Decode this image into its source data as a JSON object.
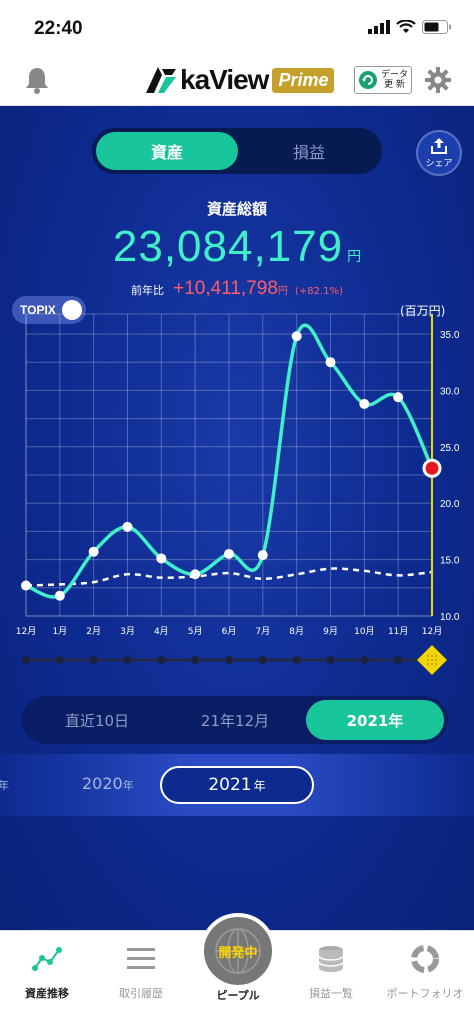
{
  "status_bar": {
    "time": "22:40"
  },
  "header": {
    "logo_text": "kaView",
    "logo_badge": "Prime",
    "data_update_line1": "データ",
    "data_update_line2": "更 新"
  },
  "tabs": {
    "active": "資産",
    "inactive": "損益"
  },
  "share_label": "シェア",
  "summary": {
    "label": "資産総額",
    "value": "23,084,179",
    "unit": "円",
    "yoy_label": "前年比",
    "yoy_value": "+10,411,798",
    "yoy_unit": "円",
    "yoy_pct": "(+82.1%)"
  },
  "topix_label": "TOPIX",
  "topix_on": true,
  "chart_data": {
    "type": "line",
    "categories": [
      "12月",
      "1月",
      "2月",
      "3月",
      "4月",
      "5月",
      "6月",
      "7月",
      "8月",
      "9月",
      "10月",
      "11月",
      "12月"
    ],
    "ylabel": "(百万円)",
    "ylim": [
      10.0,
      35.0
    ],
    "yticks": [
      "10.0",
      "15.0",
      "20.0",
      "25.0",
      "30.0",
      "35.0"
    ],
    "series": [
      {
        "values": [
          12.7,
          11.8,
          15.7,
          17.9,
          15.1,
          13.7,
          15.5,
          15.4,
          34.8,
          32.5,
          28.8,
          29.4,
          23.1
        ]
      },
      {
        "values": [
          12.7,
          12.8,
          13.0,
          13.7,
          13.4,
          13.5,
          13.8,
          13.3,
          13.7,
          14.2,
          14.0,
          13.6,
          13.9
        ]
      }
    ],
    "grid": true,
    "highlight_index": 12
  },
  "colors": {
    "asset_line": "#3ff0c9",
    "topix_line": "#ffffff",
    "current_marker": "#e8161f",
    "cursor_line": "#f2d400"
  },
  "range_tabs": {
    "items": [
      "直近10日",
      "21年12月"
    ],
    "active": "2021年"
  },
  "years": {
    "prev_partial": "年",
    "prev": "2020",
    "prev_unit": "年",
    "current": "2021",
    "current_unit": "年"
  },
  "nav": {
    "items": [
      "資産推移",
      "取引履歴",
      "損益一覧",
      "ポートフォリオ"
    ],
    "center_badge": "開発中",
    "center_label": "ピープル"
  }
}
